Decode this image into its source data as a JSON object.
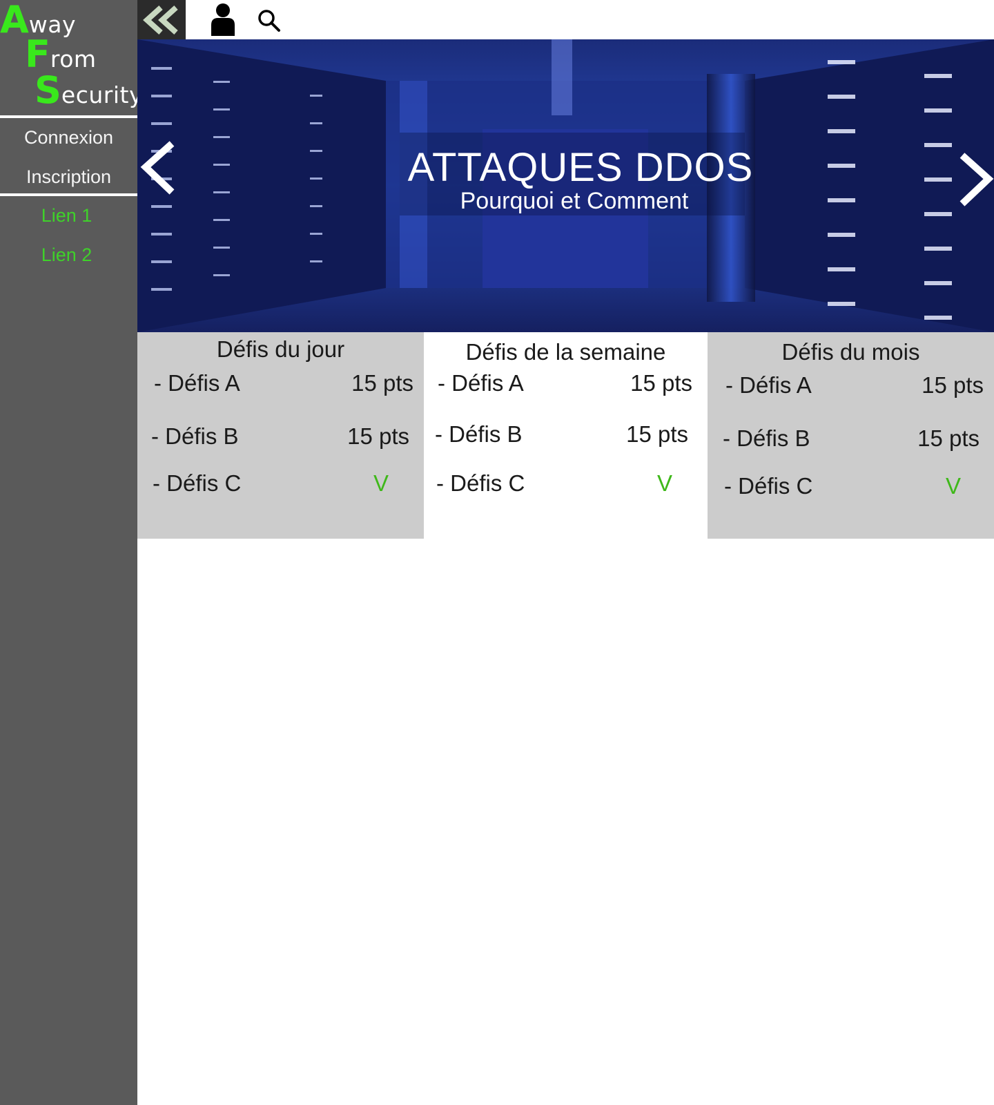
{
  "logo": {
    "line1": {
      "initial": "A",
      "rest": "way"
    },
    "line2": {
      "initial": "F",
      "rest": "rom"
    },
    "line3": {
      "initial": "S",
      "rest": "ecurity"
    }
  },
  "sidebar": {
    "items": [
      {
        "label": "Connexion"
      },
      {
        "label": "Inscription"
      },
      {
        "label": "Lien 1"
      },
      {
        "label": "Lien 2"
      }
    ]
  },
  "toolbar": {
    "collapse_icon": "double-chevron-left-icon",
    "user_icon": "user-icon",
    "search_icon": "search-icon"
  },
  "hero": {
    "title": "ATTAQUES DDOS",
    "subtitle": "Pourquoi et Comment",
    "prev_icon": "chevron-left-icon",
    "next_icon": "chevron-right-icon"
  },
  "panels": [
    {
      "title": "Défis du jour",
      "rows": [
        {
          "label": "- Défis A",
          "value": "15 pts"
        },
        {
          "label": "- Défis B",
          "value": "15 pts"
        },
        {
          "label": "- Défis C",
          "value": "V"
        }
      ]
    },
    {
      "title": "Défis de la semaine",
      "rows": [
        {
          "label": "- Défis A",
          "value": "15 pts"
        },
        {
          "label": "- Défis B",
          "value": "15 pts"
        },
        {
          "label": "- Défis C",
          "value": "V"
        }
      ]
    },
    {
      "title": "Défis du mois",
      "rows": [
        {
          "label": "- Défis A",
          "value": "15 pts"
        },
        {
          "label": "- Défis B",
          "value": "15 pts"
        },
        {
          "label": "- Défis C",
          "value": "V"
        }
      ]
    }
  ],
  "colors": {
    "sidebar_bg": "#5a5a5a",
    "accent_green": "#39e81c",
    "panel_grey": "#cccccc",
    "check_green": "#3fb81a"
  }
}
